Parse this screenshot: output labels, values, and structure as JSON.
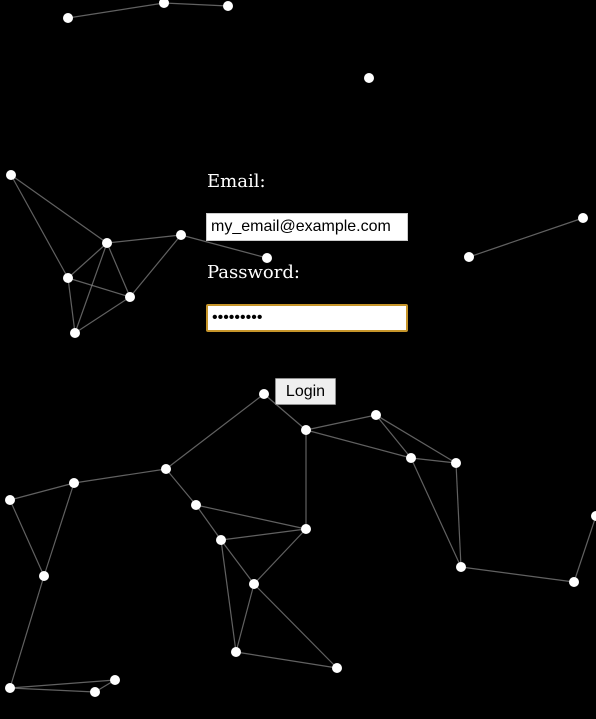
{
  "login_form": {
    "email_label": "Email:",
    "email_value": "my_email@example.com",
    "password_label": "Password:",
    "password_value": "password1",
    "login_label": "Login"
  },
  "colors": {
    "background": "#000000",
    "node": "#ffffff",
    "edge": "#8a8a8a",
    "focus_border": "#c6952a"
  }
}
